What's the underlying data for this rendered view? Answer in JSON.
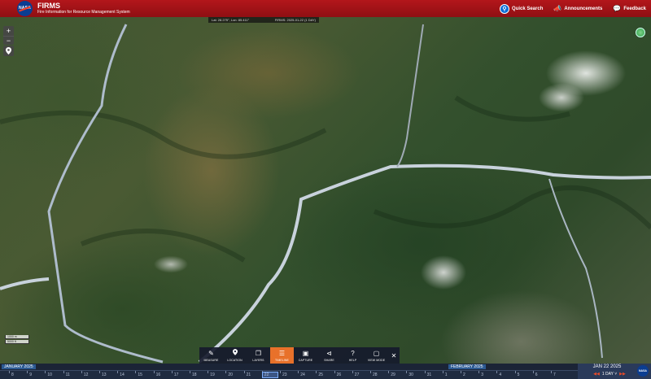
{
  "header": {
    "nasa_logo": "NASA",
    "title": "FIRMS",
    "subtitle": "Fire Information for Resource Management System",
    "quick_search": "Quick Search",
    "announcements": "Announcements",
    "feedback": "Feedback"
  },
  "coords": {
    "latlon": "Lat: 28.275°, Lon: 85.411°",
    "firms_date": "FIRMS: 2025-01-22 (1 DAY)"
  },
  "controls": {
    "zoom_in": "+",
    "zoom_out": "−"
  },
  "scale": {
    "top": "1000 m",
    "bottom": "5000 ft"
  },
  "toolbar": {
    "items": [
      {
        "label": "MEASURE",
        "icon": "ruler-icon"
      },
      {
        "label": "LOCATION",
        "icon": "location-pin-icon"
      },
      {
        "label": "LAYERS",
        "icon": "layers-icon"
      },
      {
        "label": "TIMELINE",
        "icon": "timeline-icon"
      },
      {
        "label": "CAPTURE",
        "icon": "camera-icon"
      },
      {
        "label": "SHARE",
        "icon": "share-icon"
      },
      {
        "label": "HELP",
        "icon": "help-icon"
      },
      {
        "label": "VIEW MODE",
        "icon": "monitor-icon"
      }
    ],
    "active": "TIMELINE",
    "close": "✕"
  },
  "timeline": {
    "month_left": "JANUARY 2025",
    "month_right": "FEBRUARY 2025",
    "days": [
      "8",
      "9",
      "10",
      "11",
      "12",
      "13",
      "14",
      "15",
      "16",
      "17",
      "18",
      "19",
      "20",
      "21",
      "22",
      "23",
      "24",
      "25",
      "26",
      "27",
      "28",
      "29",
      "30",
      "31",
      "1",
      "2",
      "3",
      "4",
      "5",
      "6",
      "7"
    ],
    "selected_day": "22",
    "date": "JAN 22 2025",
    "range": "1 DAY"
  },
  "colors": {
    "header": "#b3161b",
    "accent": "#e8712a",
    "timeline": "#1b2436"
  }
}
